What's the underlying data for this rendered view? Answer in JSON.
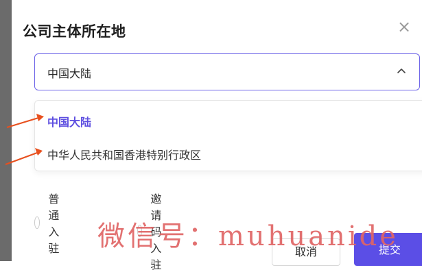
{
  "dialog": {
    "title": "公司主体所在地",
    "close_glyph": "×"
  },
  "select": {
    "value": "中国大陆",
    "options": [
      {
        "label": "中国大陆",
        "selected": true
      },
      {
        "label": "中华人民共和国香港特别行政区",
        "selected": false
      }
    ]
  },
  "radios": [
    {
      "label": "普通入驻",
      "checked": false
    },
    {
      "label": "邀请码入驻",
      "checked": false
    }
  ],
  "watermark": "微信号：muhuanide",
  "buttons": {
    "cancel": "取消",
    "submit": "提交"
  },
  "colors": {
    "accent": "#5b4ee6",
    "annotation_arrow": "#e8501e",
    "watermark": "#e06565"
  }
}
